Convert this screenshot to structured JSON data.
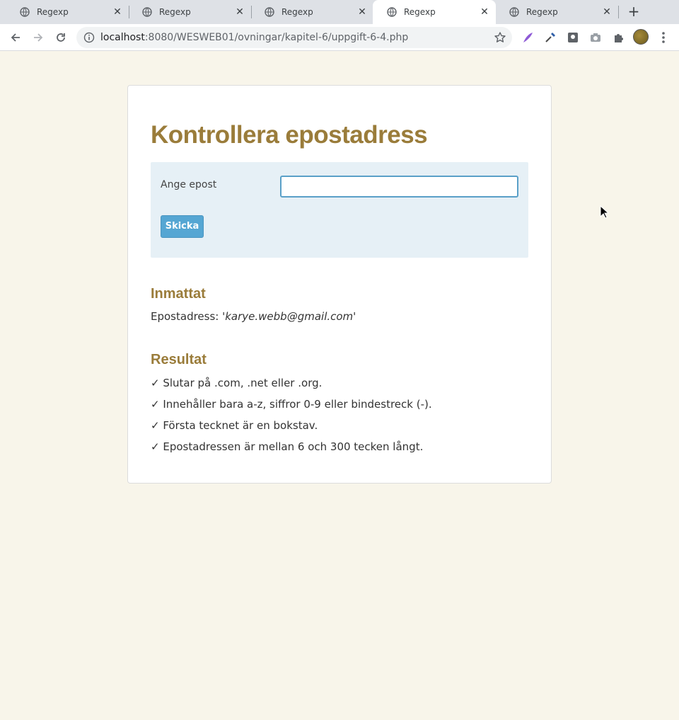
{
  "browser": {
    "tabs": [
      {
        "title": "Regexp",
        "active": false
      },
      {
        "title": "Regexp",
        "active": false
      },
      {
        "title": "Regexp",
        "active": false
      },
      {
        "title": "Regexp",
        "active": true
      },
      {
        "title": "Regexp",
        "active": false
      }
    ],
    "url_host": "localhost",
    "url_path": ":8080/WESWEB01/ovningar/kapitel-6/uppgift-6-4.php"
  },
  "page": {
    "title": "Kontrollera epostadress",
    "form": {
      "label": "Ange epost",
      "input_value": "",
      "submit_label": "Skicka"
    },
    "input_section": {
      "heading": "Inmattat",
      "label": "Epostadress:",
      "value": "'karye.webb@gmail.com'"
    },
    "result_section": {
      "heading": "Resultat",
      "items": [
        "✓ Slutar på .com, .net eller .org.",
        "✓ Innehåller bara a-z, siffror 0-9 eller bindestreck (-).",
        "✓ Första tecknet är en bokstav.",
        "✓ Epostadressen är mellan 6 och 300 tecken långt."
      ]
    }
  },
  "colors": {
    "page_bg": "#f8f5ea",
    "heading": "#9a7c3a",
    "form_bg": "#e6f0f6",
    "button": "#55a6d3"
  }
}
